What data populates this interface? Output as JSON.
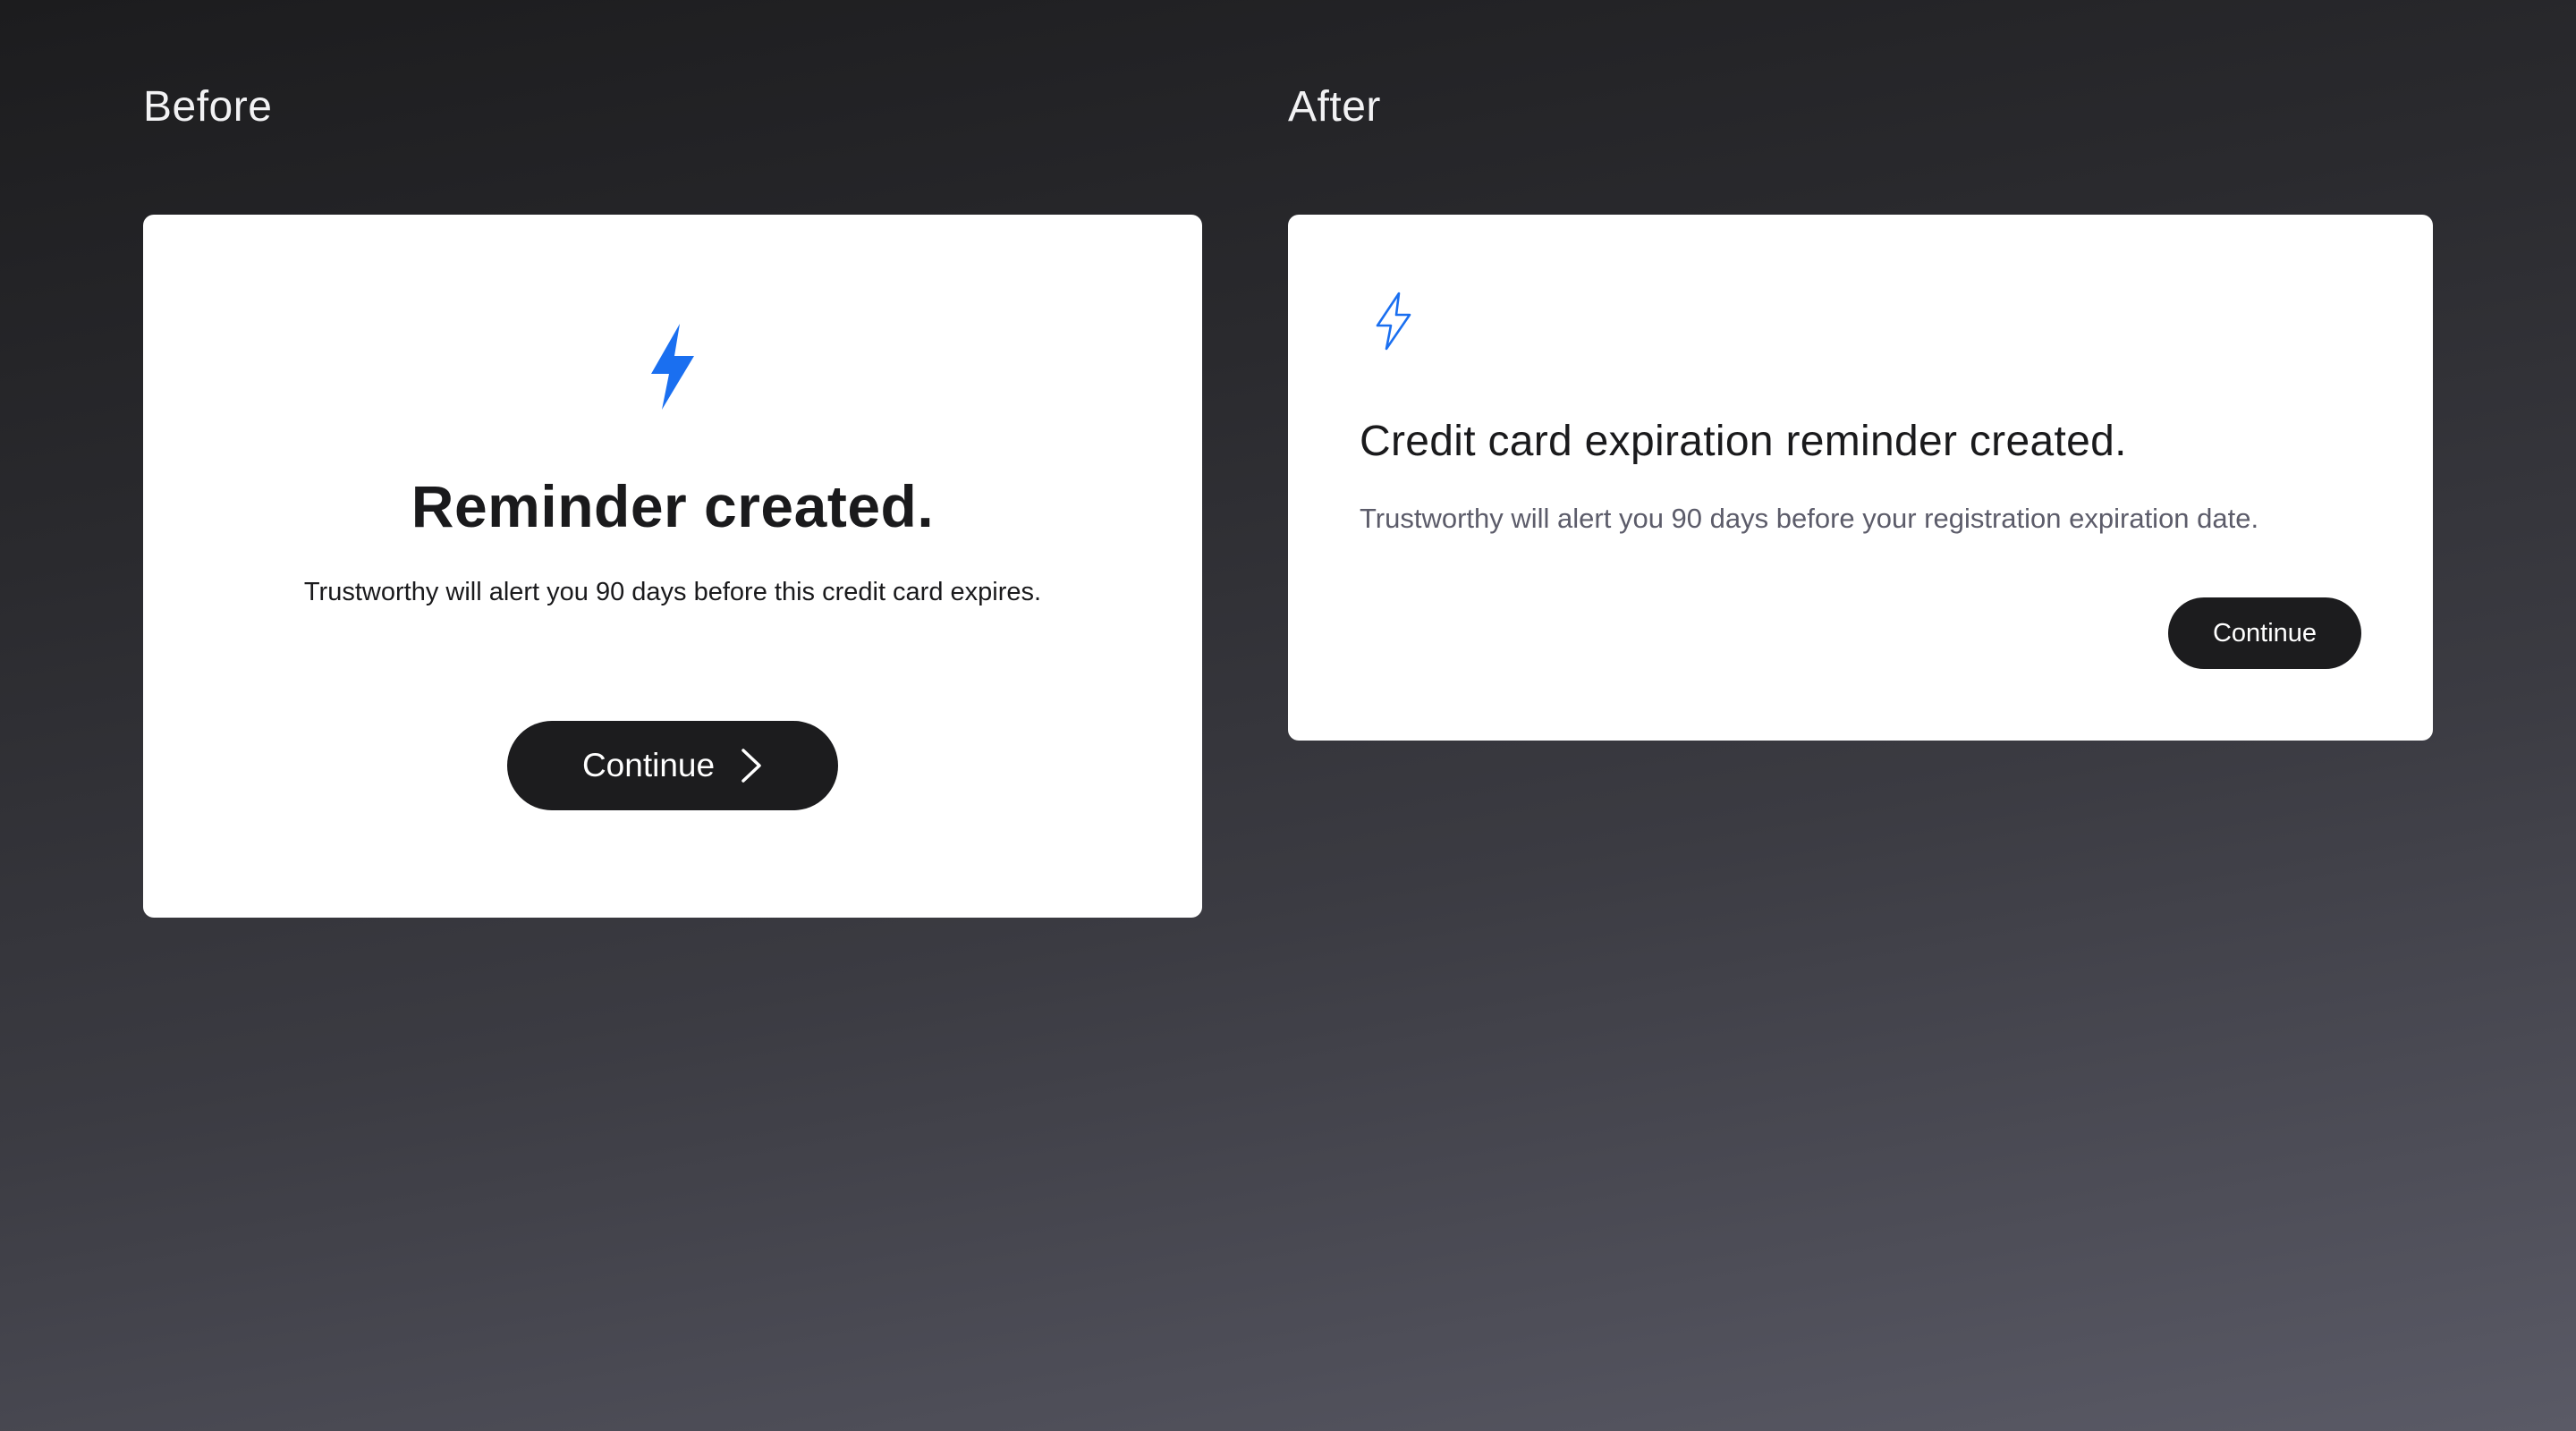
{
  "labels": {
    "before": "Before",
    "after": "After"
  },
  "before_card": {
    "icon": "lightning-bolt-filled-icon",
    "title": "Reminder created.",
    "description": "Trustworthy will alert you 90 days before this credit card expires.",
    "button_label": "Continue",
    "button_icon": "chevron-right-icon"
  },
  "after_card": {
    "icon": "lightning-bolt-outline-icon",
    "title": "Credit card expiration reminder created.",
    "description": "Trustworthy will alert you 90 days before your registration expiration date.",
    "button_label": "Continue"
  },
  "colors": {
    "accent": "#1a6ff0",
    "button_bg": "#1c1c1e",
    "card_bg": "#ffffff"
  }
}
